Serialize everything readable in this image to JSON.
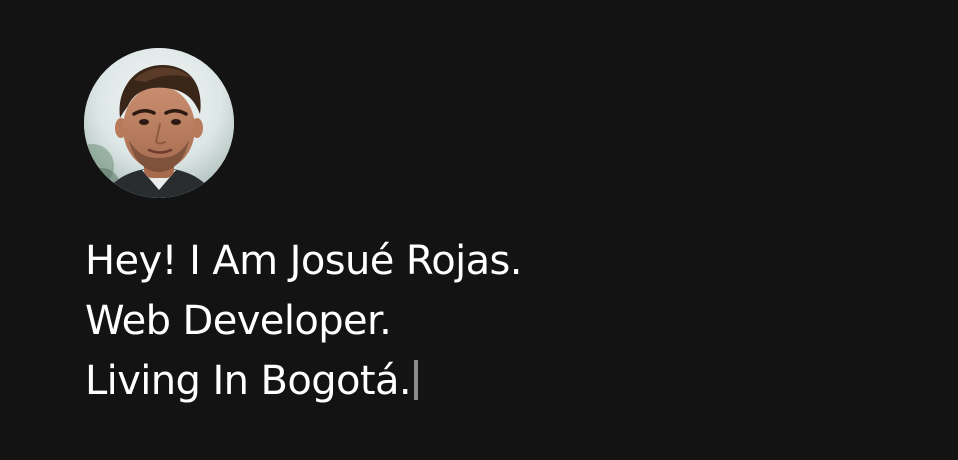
{
  "profile": {
    "avatar_icon": "portrait-photo-icon",
    "intro_lines": [
      "Hey! I Am Josué Rojas.",
      "Web Developer.",
      "Living In Bogotá."
    ]
  },
  "theme": {
    "background": "#131313",
    "text": "#ffffff",
    "cursor": "#8c8c8c"
  }
}
